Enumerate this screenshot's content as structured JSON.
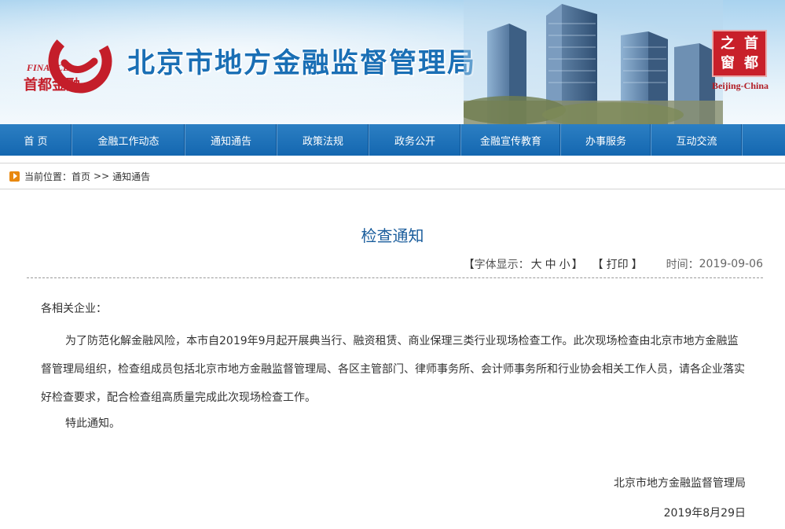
{
  "banner": {
    "logo_text": "FINANCE",
    "logo_caption": "首都金融",
    "site_title": "北京市地方金融监督管理局",
    "seal_chars": [
      "之",
      "首",
      "窗",
      "都"
    ],
    "seal_caption": "Beijing-China"
  },
  "nav": {
    "items": [
      {
        "label": "首  页"
      },
      {
        "label": "金融工作动态"
      },
      {
        "label": "通知通告"
      },
      {
        "label": "政策法规"
      },
      {
        "label": "政务公开"
      },
      {
        "label": "金融宣传教育"
      },
      {
        "label": "办事服务"
      },
      {
        "label": "互动交流"
      }
    ]
  },
  "breadcrumb": {
    "prefix": "当前位置：",
    "home": "首页",
    "separator": ">>",
    "current": "通知通告"
  },
  "article": {
    "title": "检查通知",
    "meta": {
      "font_label": "字体显示：",
      "size_large": "大",
      "size_medium": "中",
      "size_small": "小",
      "print": "打印",
      "bracket_open": "【",
      "bracket_close": "】",
      "time_label": "时间：",
      "time_value": "2019-09-06"
    },
    "greeting": "各相关企业：",
    "paragraph": "为了防范化解金融风险，本市自2019年9月起开展典当行、融资租赁、商业保理三类行业现场检查工作。此次现场检查由北京市地方金融监督管理局组织，检查组成员包括北京市地方金融监督管理局、各区主管部门、律师事务所、会计师事务所和行业协会相关工作人员，请各企业落实好检查要求，配合检查组高质量完成此次现场检查工作。",
    "closing": "特此通知。",
    "signature_org": "北京市地方金融监督管理局",
    "signature_date": "2019年8月29日"
  },
  "colors": {
    "nav_blue": "#1a6fb7",
    "title_blue": "#1a5d9c",
    "seal_red": "#c8202a",
    "logo_red": "#c41e2a"
  }
}
